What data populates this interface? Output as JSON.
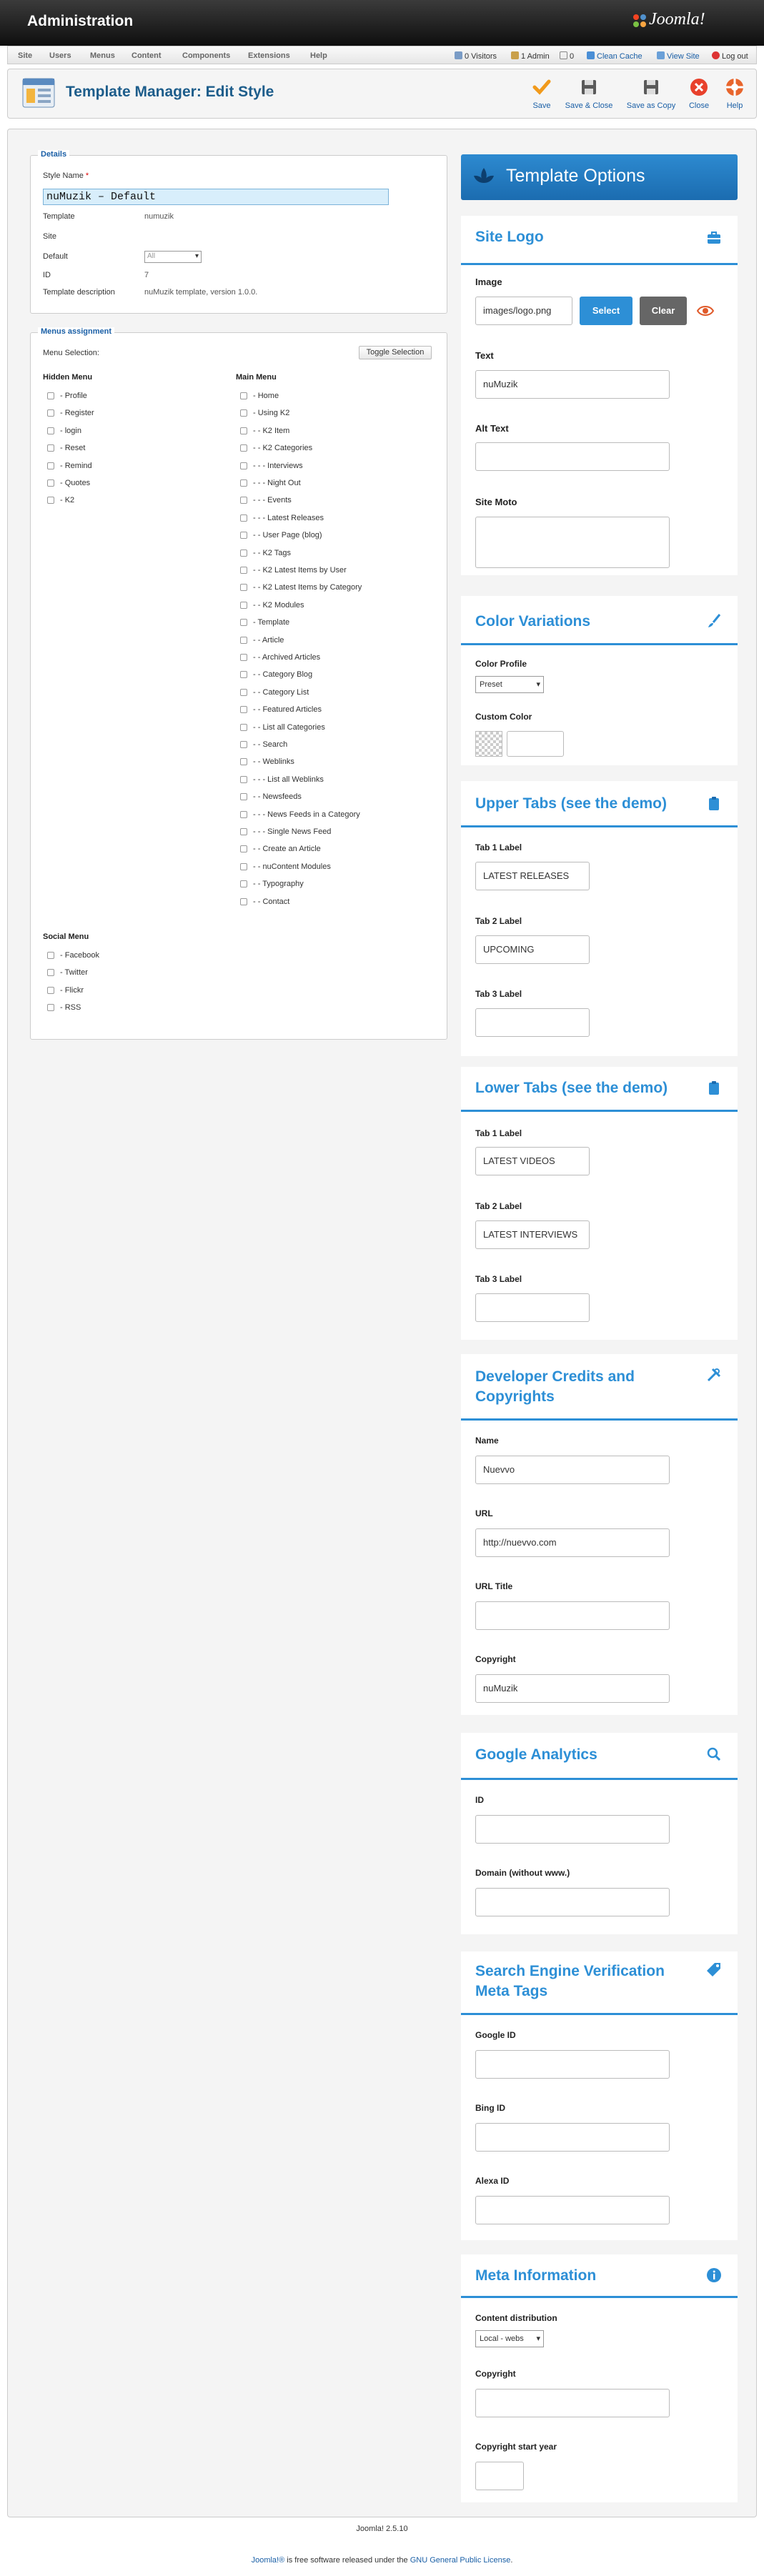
{
  "header": {
    "title": "Administration",
    "logo_text": "Joomla!"
  },
  "menubar": {
    "items": [
      "Site",
      "Users",
      "Menus",
      "Content",
      "Components",
      "Extensions",
      "Help"
    ],
    "status": {
      "visitors": "0 Visitors",
      "admins": "1 Admin",
      "messages": "0",
      "clean_cache": "Clean Cache",
      "view_site": "View Site",
      "logout": "Log out"
    }
  },
  "toolbar": {
    "title": "Template Manager: Edit Style",
    "buttons": {
      "save": "Save",
      "save_close": "Save & Close",
      "save_copy": "Save as Copy",
      "close": "Close",
      "help": "Help"
    }
  },
  "details": {
    "legend": "Details",
    "style_name_label": "Style Name",
    "required_mark": "*",
    "style_name_value": "nuMuzik – Default",
    "template_label": "Template",
    "template_value": "numuzik",
    "site_label": "Site",
    "default_label": "Default",
    "default_value": "All",
    "id_label": "ID",
    "id_value": "7",
    "description_label": "Template description",
    "description_value": "nuMuzik template, version 1.0.0."
  },
  "menus": {
    "legend": "Menus assignment",
    "selection_label": "Menu Selection:",
    "toggle_label": "Toggle Selection",
    "hidden_title": "Hidden Menu",
    "hidden_items": [
      "- Profile",
      "- Register",
      "- login",
      "- Reset",
      "- Remind",
      "- Quotes",
      "- K2"
    ],
    "social_title": "Social Menu",
    "social_items": [
      "- Facebook",
      "- Twitter",
      "- Flickr",
      "- RSS"
    ],
    "main_title": "Main Menu",
    "main_items": [
      "- Home",
      "- Using K2",
      "- - K2 Item",
      "- - K2 Categories",
      "- - - Interviews",
      "- - - Night Out",
      "- - - Events",
      "- - - Latest Releases",
      "- - User Page (blog)",
      "- - K2 Tags",
      "- - K2 Latest Items by User",
      "- - K2 Latest Items by Category",
      "- - K2 Modules",
      "- Template",
      "- - Article",
      "- - Archived Articles",
      "- - Category Blog",
      "- - Category List",
      "- - Featured Articles",
      "- - List all Categories",
      "- - Search",
      "- - Weblinks",
      "- - - List all Weblinks",
      "- - Newsfeeds",
      "- - - News Feeds in a Category",
      "- - - Single News Feed",
      "- - Create an Article",
      "- - nuContent Modules",
      "- - Typography",
      "- - Contact"
    ]
  },
  "options": {
    "title": "Template Options",
    "site_logo": {
      "title": "Site Logo",
      "image_label": "Image",
      "image_value": "images/logo.png",
      "select": "Select",
      "clear": "Clear",
      "text_label": "Text",
      "text_value": "nuMuzik",
      "alt_label": "Alt Text",
      "moto_label": "Site Moto"
    },
    "color": {
      "title": "Color Variations",
      "profile_label": "Color Profile",
      "profile_value": "Preset",
      "custom_label": "Custom Color"
    },
    "upper_tabs": {
      "title": "Upper Tabs (see the demo)",
      "tab1_label": "Tab 1 Label",
      "tab1_value": "LATEST RELEASES",
      "tab2_label": "Tab 2 Label",
      "tab2_value": "UPCOMING",
      "tab3_label": "Tab 3 Label"
    },
    "lower_tabs": {
      "title": "Lower Tabs (see the demo)",
      "tab1_label": "Tab 1 Label",
      "tab1_value": "LATEST VIDEOS",
      "tab2_label": "Tab 2 Label",
      "tab2_value": "LATEST INTERVIEWS",
      "tab3_label": "Tab 3 Label"
    },
    "credits": {
      "title_line1": "Developer Credits and",
      "title_line2": "Copyrights",
      "name_label": "Name",
      "name_value": "Nuevvo",
      "url_label": "URL",
      "url_value": "http://nuevvo.com",
      "url_title_label": "URL Title",
      "copyright_label": "Copyright",
      "copyright_value": "nuMuzik"
    },
    "analytics": {
      "title": "Google Analytics",
      "id_label": "ID",
      "domain_label": "Domain (without www.)"
    },
    "seo": {
      "title_line1": "Search Engine Verification",
      "title_line2": "Meta Tags",
      "google_label": "Google ID",
      "bing_label": "Bing ID",
      "alexa_label": "Alexa ID"
    },
    "meta": {
      "title": "Meta Information",
      "distribution_label": "Content distribution",
      "distribution_value": "Local - webs",
      "copyright_label": "Copyright",
      "start_year_label": "Copyright start year"
    }
  },
  "footer": {
    "version": "Joomla! 2.5.10",
    "license_prefix": "Joomla!®",
    "license_middle": " is free software released under the ",
    "license_link": "GNU General Public License",
    "license_suffix": "."
  },
  "colors": {
    "accent": "#2d8fd6",
    "header_bg": "#1b6cb0",
    "title_blue": "#1d5d8b"
  },
  "icons": [
    "joomla-logo-icon",
    "template-manager-icon",
    "save-icon",
    "save-close-icon",
    "save-copy-icon",
    "close-icon",
    "help-icon",
    "template-options-icon",
    "briefcase-icon",
    "eye-icon",
    "brush-icon",
    "clipboard-icon",
    "tools-icon",
    "search-icon",
    "tag-icon",
    "info-icon"
  ]
}
